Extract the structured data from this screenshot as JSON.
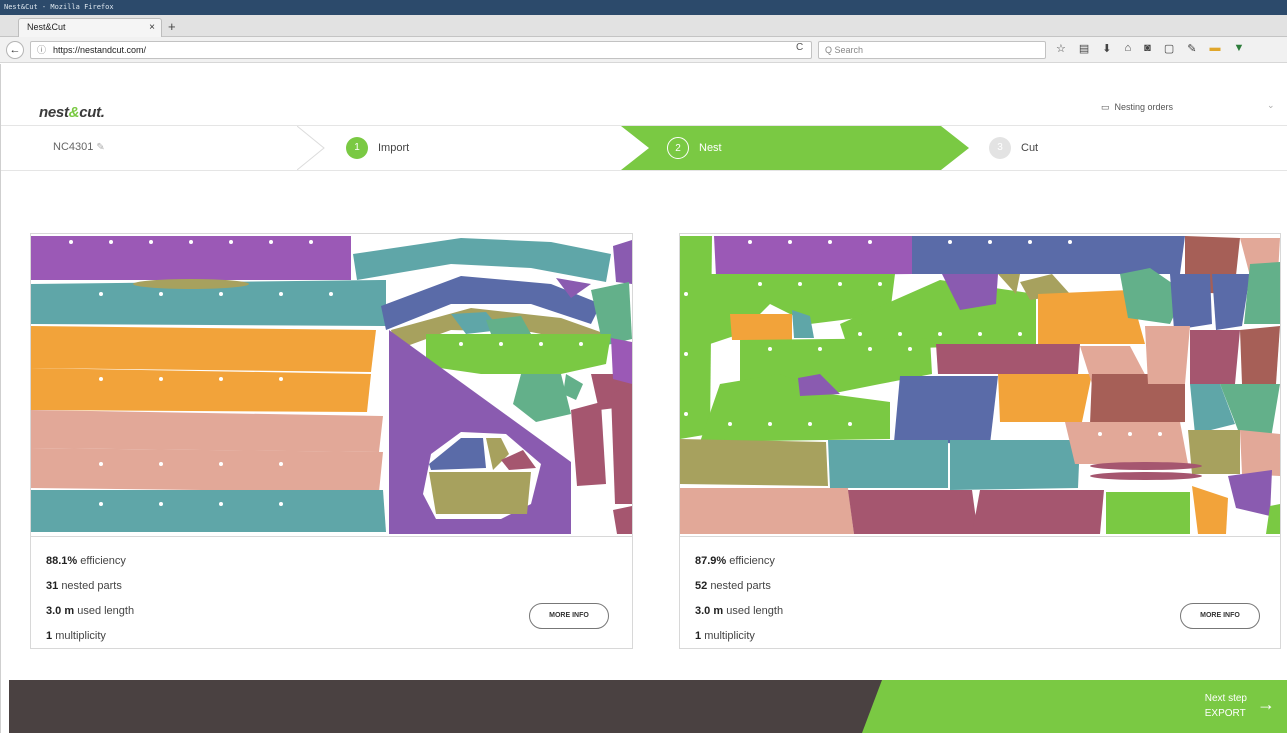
{
  "window": {
    "title": "Nest&Cut - Mozilla Firefox"
  },
  "browser": {
    "tab_title": "Nest&Cut",
    "tab_close": "×",
    "new_tab": "+",
    "back": "←",
    "url_info": "ⓘ",
    "url": "https://nestandcut.com/",
    "reload": "C",
    "search_placeholder": "Q Search",
    "toolbar_icons": [
      "star-icon",
      "clipboard-icon",
      "download-icon",
      "home-icon",
      "pocket-icon",
      "sync-icon",
      "tools-icon",
      "wallet-icon",
      "menu-icon"
    ]
  },
  "app": {
    "logo_prefix": "nest",
    "logo_amp": "&",
    "logo_suffix": "cut.",
    "orders_label": "Nesting orders",
    "orders_icon": "folder-icon"
  },
  "stepper": {
    "order_id": "NC4301",
    "steps": [
      {
        "number": "1",
        "label": "Import",
        "state": "done"
      },
      {
        "number": "2",
        "label": "Nest",
        "state": "active"
      },
      {
        "number": "3",
        "label": "Cut",
        "state": "pending"
      }
    ]
  },
  "results": [
    {
      "efficiency_value": "88.1%",
      "efficiency_label": "efficiency",
      "parts_value": "31",
      "parts_label": "nested parts",
      "length_value": "3.0 m",
      "length_label": "used length",
      "multiplicity_value": "1",
      "multiplicity_label": "multiplicity",
      "button": "MORE INFO"
    },
    {
      "efficiency_value": "87.9%",
      "efficiency_label": "efficiency",
      "parts_value": "52",
      "parts_label": "nested parts",
      "length_value": "3.0 m",
      "length_label": "used length",
      "multiplicity_value": "1",
      "multiplicity_label": "multiplicity",
      "button": "MORE INFO"
    }
  ],
  "footer": {
    "next_line1": "Next step",
    "next_line2": "EXPORT"
  },
  "colors": {
    "brand_green": "#7ac943",
    "footer_dark": "#4a4141",
    "part_purple": "#9b59b6",
    "part_teal": "#5fa6a8",
    "part_orange": "#f2a33a",
    "part_pink": "#e2a898",
    "part_olive": "#a7a15e",
    "part_violet": "#8a5bb0",
    "part_blue": "#5a6ba8",
    "part_maroon": "#a5566f",
    "part_brown": "#a65f57"
  }
}
